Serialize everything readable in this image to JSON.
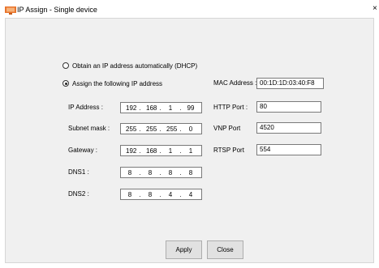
{
  "window": {
    "title": "IP Assign - Single device",
    "app_icon": "display-monitor-icon",
    "close_glyph": "×"
  },
  "dhcp_option": {
    "label": "Obtain an IP address automatically (DHCP)",
    "selected": false
  },
  "static_option": {
    "label": "Assign the following IP address",
    "selected": true
  },
  "ip_address": {
    "label": "IP Address :",
    "octets": [
      "192",
      "168",
      "1",
      "99"
    ]
  },
  "subnet_mask": {
    "label": "Subnet mask :",
    "octets": [
      "255",
      "255",
      "255",
      "0"
    ]
  },
  "gateway": {
    "label": "Gateway :",
    "octets": [
      "192",
      "168",
      "1",
      "1"
    ]
  },
  "dns1": {
    "label": "DNS1 :",
    "octets": [
      "8",
      "8",
      "8",
      "8"
    ]
  },
  "dns2": {
    "label": "DNS2 :",
    "octets": [
      "8",
      "8",
      "4",
      "4"
    ]
  },
  "mac_address": {
    "label": "MAC Address :",
    "value": "00:1D:1D:03:40:F8"
  },
  "http_port": {
    "label": "HTTP Port :",
    "value": "80"
  },
  "vnp_port": {
    "label": "VNP Port",
    "value": "4520"
  },
  "rtsp_port": {
    "label": "RTSP Port",
    "value": "554"
  },
  "buttons": {
    "apply": "Apply",
    "close": "Close"
  }
}
